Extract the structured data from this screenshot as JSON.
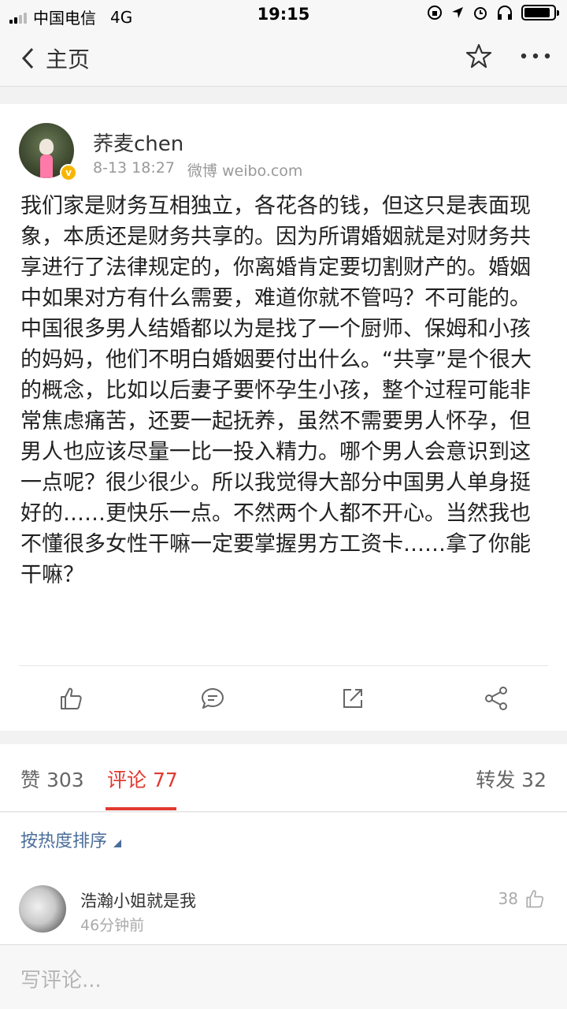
{
  "status_bar": {
    "carrier": "中国电信",
    "network": "4G",
    "time": "19:15"
  },
  "nav": {
    "back_label": "主页"
  },
  "post": {
    "author": "荞麦chen",
    "date": "8-13 18:27",
    "source": "微博 weibo.com",
    "verified_badge": "v",
    "content": "我们家是财务互相独立，各花各的钱，但这只是表面现象，本质还是财务共享的。因为所谓婚姻就是对财务共享进行了法律规定的，你离婚肯定要切割财产的。婚姻中如果对方有什么需要，难道你就不管吗？不可能的。中国很多男人结婚都以为是找了一个厨师、保姆和小孩的妈妈，他们不明白婚姻要付出什么。“共享”是个很大的概念，比如以后妻子要怀孕生小孩，整个过程可能非常焦虑痛苦，还要一起抚养，虽然不需要男人怀孕，但男人也应该尽量一比一投入精力。哪个男人会意识到这一点呢？很少很少。所以我觉得大部分中国男人单身挺好的……更快乐一点。不然两个人都不开心。当然我也不懂很多女性干嘛一定要掌握男方工资卡……拿了你能干嘛？"
  },
  "tabs": {
    "likes": "赞 303",
    "comments": "评论 77",
    "reposts": "转发 32"
  },
  "sort": {
    "label": "按热度排序"
  },
  "comment": {
    "name": "浩瀚小姐就是我",
    "time": "46分钟前",
    "likes": "38"
  },
  "compose": {
    "placeholder": "写评论..."
  },
  "colors": {
    "accent": "#e03a30",
    "link": "#4a6d9a"
  },
  "icons": [
    "back-icon",
    "star-icon",
    "more-icon",
    "like-icon",
    "comment-icon",
    "share-icon",
    "forward-icon"
  ]
}
